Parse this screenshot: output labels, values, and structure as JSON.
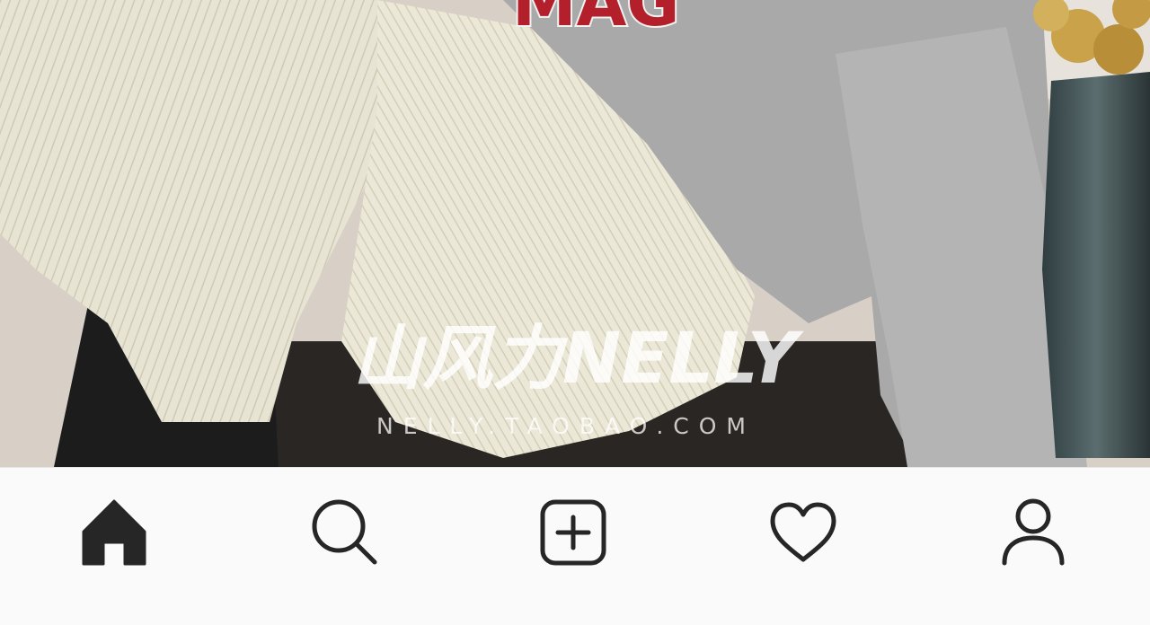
{
  "photo": {
    "watermark": {
      "logo_text": "山风力NELLY",
      "url": "NELLY.TAOBAO.COM"
    },
    "sweatshirt_print": "MAG"
  },
  "bottom_nav": {
    "items": [
      {
        "icon": "home-icon",
        "label": "Home",
        "active": true
      },
      {
        "icon": "search-icon",
        "label": "Search",
        "active": false
      },
      {
        "icon": "add-post-icon",
        "label": "New Post",
        "active": false
      },
      {
        "icon": "heart-icon",
        "label": "Activity",
        "active": false
      },
      {
        "icon": "profile-icon",
        "label": "Profile",
        "active": false
      }
    ]
  },
  "colors": {
    "nav_background": "#fafafa",
    "icon_color": "#262626",
    "sweatshirt_gray": "#a9a9a9",
    "corduroy_cream": "#e6e3d2",
    "print_red": "#b3202b"
  }
}
